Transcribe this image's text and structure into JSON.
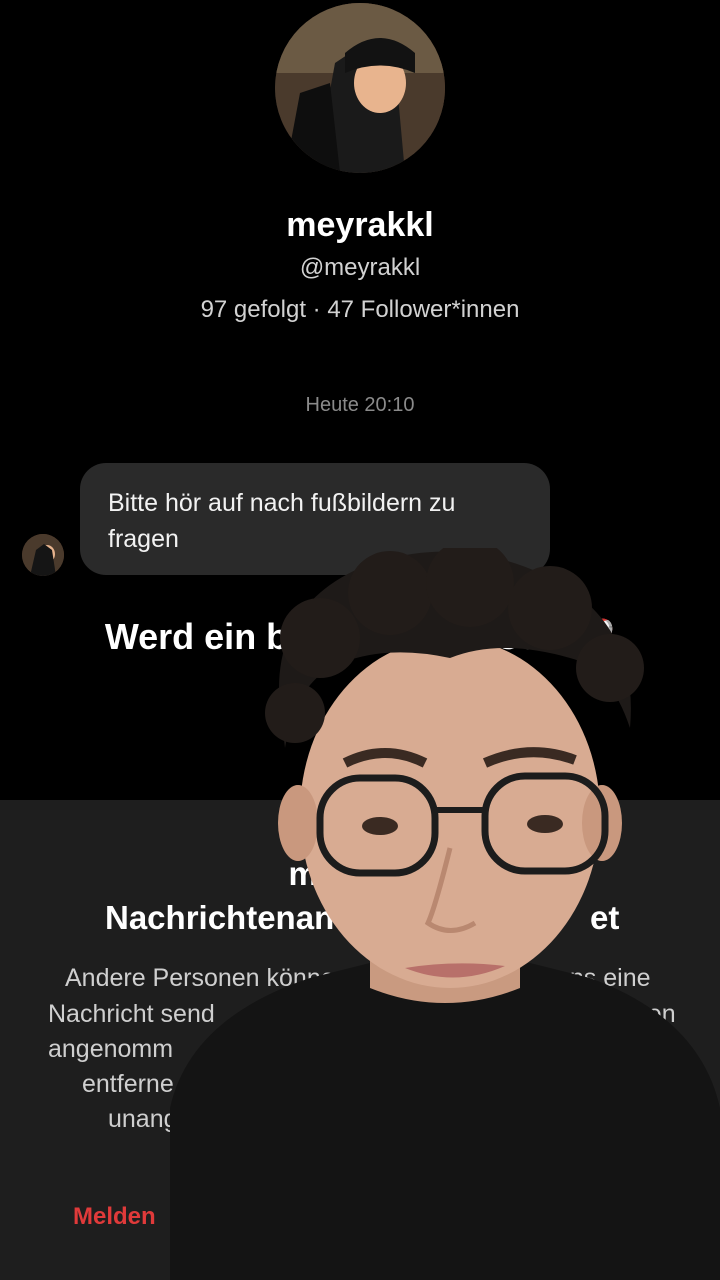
{
  "profile": {
    "display_name": "meyrakkl",
    "handle": "@meyrakkl",
    "stats": "97 gefolgt · 47 Follower*innen"
  },
  "chat": {
    "timestamp": "Heute 20:10",
    "message": "Bitte hör auf nach fußbildern zu fragen"
  },
  "overlay": {
    "caption": "Werd ein besserer Mensch.",
    "caption_emoji": "❤️‍🩹"
  },
  "sheet": {
    "title_line1": "meyrakkl",
    "title_line2": "Nachrichtenan",
    "title_line2_tail": "et",
    "body_lines": [
      "Andere Personen könne",
      "ens eine",
      "Nachricht send",
      "agen",
      "angenomm",
      "entferne",
      "unang"
    ],
    "report_label": "Melden"
  }
}
